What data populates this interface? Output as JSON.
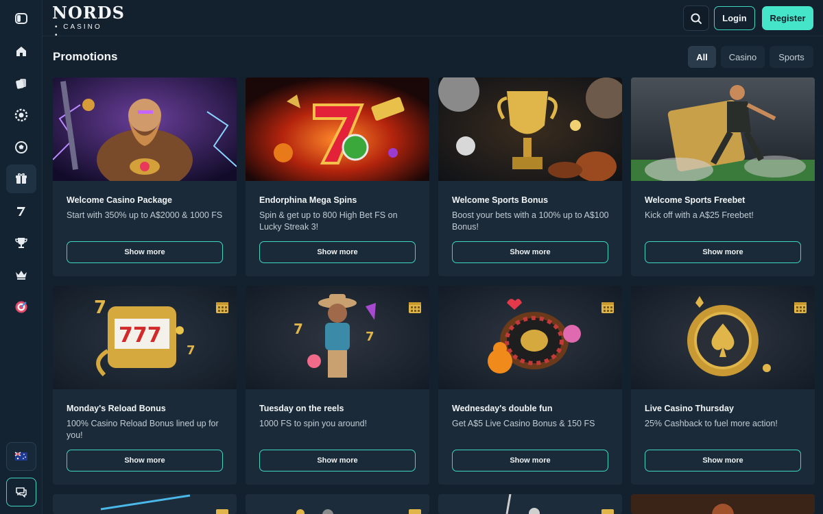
{
  "header": {
    "logo_main": "NORDS",
    "logo_sub": "• CASINO •",
    "login_label": "Login",
    "register_label": "Register"
  },
  "sidebar": {
    "items": [
      "toggle-menu",
      "home",
      "casino",
      "live-casino",
      "sports",
      "promotions",
      "slots",
      "tournaments",
      "vip",
      "bonus-wheel"
    ],
    "active": "promotions",
    "bottom": [
      "language-au-flag",
      "chat"
    ]
  },
  "page": {
    "title": "Promotions",
    "filters": [
      {
        "label": "All",
        "active": true
      },
      {
        "label": "Casino",
        "active": false
      },
      {
        "label": "Sports",
        "active": false
      }
    ]
  },
  "promotions": [
    {
      "title": "Welcome Casino Package",
      "desc": "Start with 350% up to A$2000 & 1000 FS",
      "button": "Show more",
      "image": "viking-warrior"
    },
    {
      "title": "Endorphina Mega Spins",
      "desc": "Spin & get up to 800 High Bet FS on Lucky Streak 3!",
      "button": "Show more",
      "image": "lucky-seven-fire"
    },
    {
      "title": "Welcome Sports Bonus",
      "desc": "Boost your bets with a 100% up to A$100 Bonus!",
      "button": "Show more",
      "image": "gold-trophy"
    },
    {
      "title": "Welcome Sports Freebet",
      "desc": "Kick off with a A$25 Freebet!",
      "button": "Show more",
      "image": "football-player"
    },
    {
      "title": "Monday's Reload Bonus",
      "desc": "100% Casino Reload Bonus lined up for you!",
      "button": "Show more",
      "image": "slot-machine-777"
    },
    {
      "title": "Tuesday on the reels",
      "desc": "1000 FS to spin you around!",
      "button": "Show more",
      "image": "cowboy-character"
    },
    {
      "title": "Wednesday's double fun",
      "desc": "Get A$5 Live Casino Bonus & 150 FS",
      "button": "Show more",
      "image": "roulette-wheel"
    },
    {
      "title": "Live Casino Thursday",
      "desc": "25% Cashback to fuel more action!",
      "button": "Show more",
      "image": "spade-chip"
    }
  ],
  "colors": {
    "background": "#13212e",
    "card": "#1a2a38",
    "accent": "#45e5ca",
    "outline": "#3fd8c4",
    "gold": "#e0b64a"
  }
}
